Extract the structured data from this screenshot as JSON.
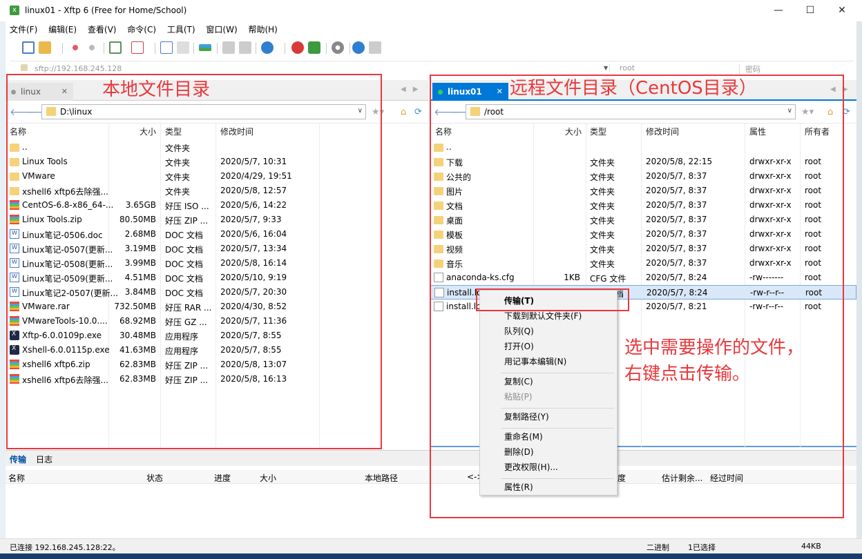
{
  "window": {
    "title": "linux01   - Xftp 6 (Free for Home/School)",
    "controls": [
      "—",
      "☐",
      "✕"
    ]
  },
  "menu": [
    "文件(F)",
    "编辑(E)",
    "查看(V)",
    "命令(C)",
    "工具(T)",
    "窗口(W)",
    "帮助(H)"
  ],
  "address": {
    "url": "sftp://192.168.245.128",
    "user_placeholder": "root",
    "password_placeholder": "密码"
  },
  "local": {
    "tab": "linux",
    "path": "D:\\linux",
    "columns": [
      "名称",
      "大小",
      "类型",
      "修改时间"
    ],
    "rows": [
      {
        "icon": "folder",
        "name": "..",
        "size": "",
        "type": "文件夹",
        "mtime": ""
      },
      {
        "icon": "folder",
        "name": "Linux Tools",
        "size": "",
        "type": "文件夹",
        "mtime": "2020/5/7, 10:31"
      },
      {
        "icon": "folder",
        "name": "VMware",
        "size": "",
        "type": "文件夹",
        "mtime": "2020/4/29, 19:51"
      },
      {
        "icon": "folder",
        "name": "xshell6 xftp6去除强...",
        "size": "",
        "type": "文件夹",
        "mtime": "2020/5/8, 12:57"
      },
      {
        "icon": "zip",
        "name": "CentOS-6.8-x86_64-...",
        "size": "3.65GB",
        "type": "好压 ISO ...",
        "mtime": "2020/5/6, 14:22"
      },
      {
        "icon": "zip",
        "name": "Linux Tools.zip",
        "size": "80.50MB",
        "type": "好压 ZIP ...",
        "mtime": "2020/5/7, 9:33"
      },
      {
        "icon": "doc",
        "name": "Linux笔记-0506.doc",
        "size": "2.68MB",
        "type": "DOC 文档",
        "mtime": "2020/5/6, 16:04"
      },
      {
        "icon": "doc",
        "name": "Linux笔记-0507(更新...",
        "size": "3.19MB",
        "type": "DOC 文档",
        "mtime": "2020/5/7, 13:34"
      },
      {
        "icon": "doc",
        "name": "Linux笔记-0508(更新...",
        "size": "3.99MB",
        "type": "DOC 文档",
        "mtime": "2020/5/8, 16:14"
      },
      {
        "icon": "doc",
        "name": "Linux笔记-0509(更新...",
        "size": "4.51MB",
        "type": "DOC 文档",
        "mtime": "2020/5/10, 9:19"
      },
      {
        "icon": "doc",
        "name": "Linux笔记2-0507(更新...",
        "size": "3.84MB",
        "type": "DOC 文档",
        "mtime": "2020/5/7, 20:30"
      },
      {
        "icon": "zip",
        "name": "VMware.rar",
        "size": "732.50MB",
        "type": "好压 RAR ...",
        "mtime": "2020/4/30, 8:52"
      },
      {
        "icon": "zip",
        "name": "VMwareTools-10.0....",
        "size": "68.92MB",
        "type": "好压 GZ ...",
        "mtime": "2020/5/7, 11:36"
      },
      {
        "icon": "exe",
        "name": "Xftp-6.0.0109p.exe",
        "size": "30.48MB",
        "type": "应用程序",
        "mtime": "2020/5/7, 8:55"
      },
      {
        "icon": "exe",
        "name": "Xshell-6.0.0115p.exe",
        "size": "41.63MB",
        "type": "应用程序",
        "mtime": "2020/5/7, 8:55"
      },
      {
        "icon": "zip",
        "name": "xshell6 xftp6.zip",
        "size": "62.83MB",
        "type": "好压 ZIP ...",
        "mtime": "2020/5/8, 13:07"
      },
      {
        "icon": "zip",
        "name": "xshell6 xftp6去除强...",
        "size": "62.83MB",
        "type": "好压 ZIP ...",
        "mtime": "2020/5/8, 16:13"
      }
    ]
  },
  "remote": {
    "tab": "linux01",
    "path": "/root",
    "columns": [
      "名称",
      "大小",
      "类型",
      "修改时间",
      "属性",
      "所有者"
    ],
    "rows": [
      {
        "icon": "folder",
        "name": "..",
        "size": "",
        "type": "",
        "mtime": "",
        "attr": "",
        "owner": ""
      },
      {
        "icon": "folder",
        "name": "下载",
        "size": "",
        "type": "文件夹",
        "mtime": "2020/5/8, 22:15",
        "attr": "drwxr-xr-x",
        "owner": "root"
      },
      {
        "icon": "folder",
        "name": "公共的",
        "size": "",
        "type": "文件夹",
        "mtime": "2020/5/7, 8:37",
        "attr": "drwxr-xr-x",
        "owner": "root"
      },
      {
        "icon": "folder",
        "name": "图片",
        "size": "",
        "type": "文件夹",
        "mtime": "2020/5/7, 8:37",
        "attr": "drwxr-xr-x",
        "owner": "root"
      },
      {
        "icon": "folder",
        "name": "文档",
        "size": "",
        "type": "文件夹",
        "mtime": "2020/5/7, 8:37",
        "attr": "drwxr-xr-x",
        "owner": "root"
      },
      {
        "icon": "folder",
        "name": "桌面",
        "size": "",
        "type": "文件夹",
        "mtime": "2020/5/7, 8:37",
        "attr": "drwxr-xr-x",
        "owner": "root"
      },
      {
        "icon": "folder",
        "name": "模板",
        "size": "",
        "type": "文件夹",
        "mtime": "2020/5/7, 8:37",
        "attr": "drwxr-xr-x",
        "owner": "root"
      },
      {
        "icon": "folder",
        "name": "视频",
        "size": "",
        "type": "文件夹",
        "mtime": "2020/5/7, 8:37",
        "attr": "drwxr-xr-x",
        "owner": "root"
      },
      {
        "icon": "folder",
        "name": "音乐",
        "size": "",
        "type": "文件夹",
        "mtime": "2020/5/7, 8:37",
        "attr": "drwxr-xr-x",
        "owner": "root"
      },
      {
        "icon": "txt",
        "name": "anaconda-ks.cfg",
        "size": "1KB",
        "type": "CFG 文件",
        "mtime": "2020/5/7, 8:24",
        "attr": "-rw-------",
        "owner": "root"
      },
      {
        "icon": "txt",
        "name": "install.log",
        "size": "44KB",
        "type": "文本文档",
        "mtime": "2020/5/7, 8:24",
        "attr": "-rw-r--r--",
        "owner": "root",
        "selected": true
      },
      {
        "icon": "txt",
        "name": "install.log",
        "size": "",
        "type": "G ...",
        "mtime": "2020/5/7, 8:21",
        "attr": "-rw-r--r--",
        "owner": "root"
      }
    ]
  },
  "transfer": {
    "tabs": [
      "传输",
      "日志"
    ],
    "columns": [
      "名称",
      "状态",
      "进度",
      "大小",
      "本地路径",
      "<->",
      "度",
      "估计剩余...",
      "经过时间"
    ]
  },
  "status": {
    "left": "已连接 192.168.245.128:22。",
    "mode": "二进制",
    "selected": "1已选择",
    "size": "44KB"
  },
  "context_menu": [
    {
      "label": "传输(T)",
      "bold": true
    },
    {
      "label": "下载到默认文件夹(F)"
    },
    {
      "label": "队列(Q)"
    },
    {
      "label": "打开(O)"
    },
    {
      "label": "用记事本编辑(N)"
    },
    {
      "sep": true
    },
    {
      "label": "复制(C)"
    },
    {
      "label": "粘贴(P)",
      "disabled": true
    },
    {
      "sep": true
    },
    {
      "label": "复制路径(Y)"
    },
    {
      "sep": true
    },
    {
      "label": "重命名(M)"
    },
    {
      "label": "删除(D)"
    },
    {
      "label": "更改权限(H)..."
    },
    {
      "sep": true
    },
    {
      "label": "属性(R)"
    }
  ],
  "annotations": {
    "local": "本地文件目录",
    "remote": "远程文件目录（CentOS目录）",
    "hint_line1": "选中需要操作的文件，",
    "hint_line2": "右键点击传输。"
  },
  "colors": {
    "accent": "#0078d7",
    "annotation": "#e8383d",
    "selection": "#d9e8f8"
  }
}
